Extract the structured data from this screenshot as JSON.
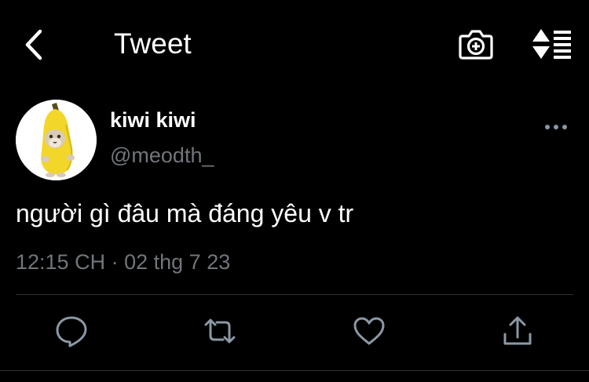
{
  "header": {
    "title": "Tweet",
    "back_icon": "chevron-left-icon",
    "camera_icon": "camera-plus-icon",
    "sort_icon": "sort-list-icon"
  },
  "tweet": {
    "display_name": "kiwi kiwi",
    "handle": "@meodth_",
    "text": "người gì đâu mà đáng yêu v tr",
    "time": "12:15 CH",
    "separator": "·",
    "date": "02 thg 7 23",
    "avatar_icon": "banana-cat-avatar",
    "more_icon": "more-horizontal-icon"
  },
  "actions": [
    {
      "name": "reply",
      "icon": "reply-icon"
    },
    {
      "name": "retweet",
      "icon": "retweet-icon"
    },
    {
      "name": "like",
      "icon": "heart-icon"
    },
    {
      "name": "share",
      "icon": "share-icon"
    }
  ],
  "colors": {
    "background": "#000000",
    "text": "#ffffff",
    "secondary_text": "#71767b",
    "icon": "#8b98a5",
    "divider": "#2f3336"
  }
}
